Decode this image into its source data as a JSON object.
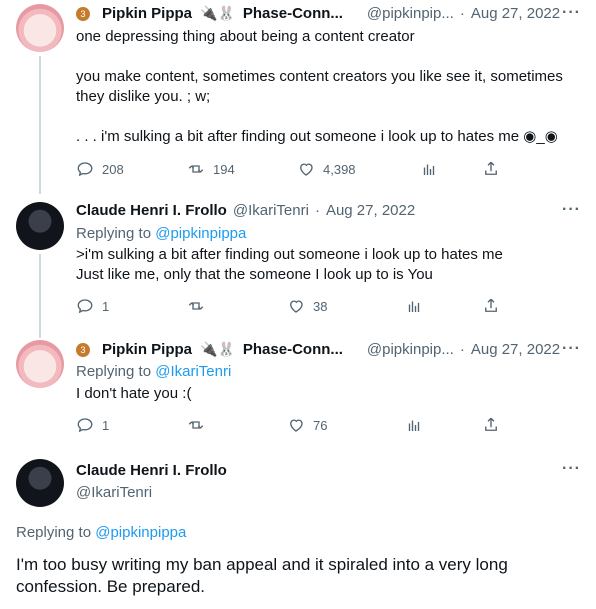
{
  "tweets": [
    {
      "display_name": "Pipkin Pippa",
      "badge": "3",
      "emoji_suffix": "🔌🐰",
      "secondary_name": "Phase-Conn...",
      "handle": "@pipkinpip...",
      "separator": "·",
      "date": "Aug 27, 2022",
      "body_lines": [
        "one depressing thing about being a content creator",
        "",
        "you make content, sometimes content creators you like see it, sometimes",
        "they dislike you. ; w;",
        "",
        ". . . i'm sulking a bit after finding out someone i look up to hates me ◉_◉"
      ],
      "stats": {
        "replies": "208",
        "retweets": "194",
        "likes": "4,398"
      }
    },
    {
      "display_name": "Claude Henri I. Frollo",
      "handle": "@IkariTenri",
      "separator": "·",
      "date": "Aug 27, 2022",
      "replying_prefix": "Replying to ",
      "replying_handle": "@pipkinpippa",
      "body_lines": [
        ">i'm sulking a bit after finding out someone i look up to hates me",
        "Just like me, only that the someone I look up to is You"
      ],
      "stats": {
        "replies": "1",
        "retweets": "",
        "likes": "38"
      }
    },
    {
      "display_name": "Pipkin Pippa",
      "badge": "3",
      "emoji_suffix": "🔌🐰",
      "secondary_name": "Phase-Conn...",
      "handle": "@pipkinpip...",
      "separator": "·",
      "date": "Aug 27, 2022",
      "replying_prefix": "Replying to ",
      "replying_handle": "@IkariTenri",
      "body_lines": [
        "I don't hate you :("
      ],
      "stats": {
        "replies": "1",
        "retweets": "",
        "likes": "76"
      }
    }
  ],
  "main_tweet": {
    "display_name": "Claude Henri I. Frollo",
    "handle": "@IkariTenri",
    "replying_prefix": "Replying to ",
    "replying_handle": "@pipkinpippa",
    "body": "I'm too busy writing my ban appeal and it spiraled into a very long confession. Be prepared."
  },
  "more_label": "···",
  "icons": [
    "reply-icon",
    "retweet-icon",
    "like-icon",
    "views-icon",
    "share-icon",
    "more-icon"
  ],
  "colors": {
    "link": "#1d9bf0",
    "muted": "#536471",
    "text": "#0f1419",
    "line": "#cfd9de"
  }
}
